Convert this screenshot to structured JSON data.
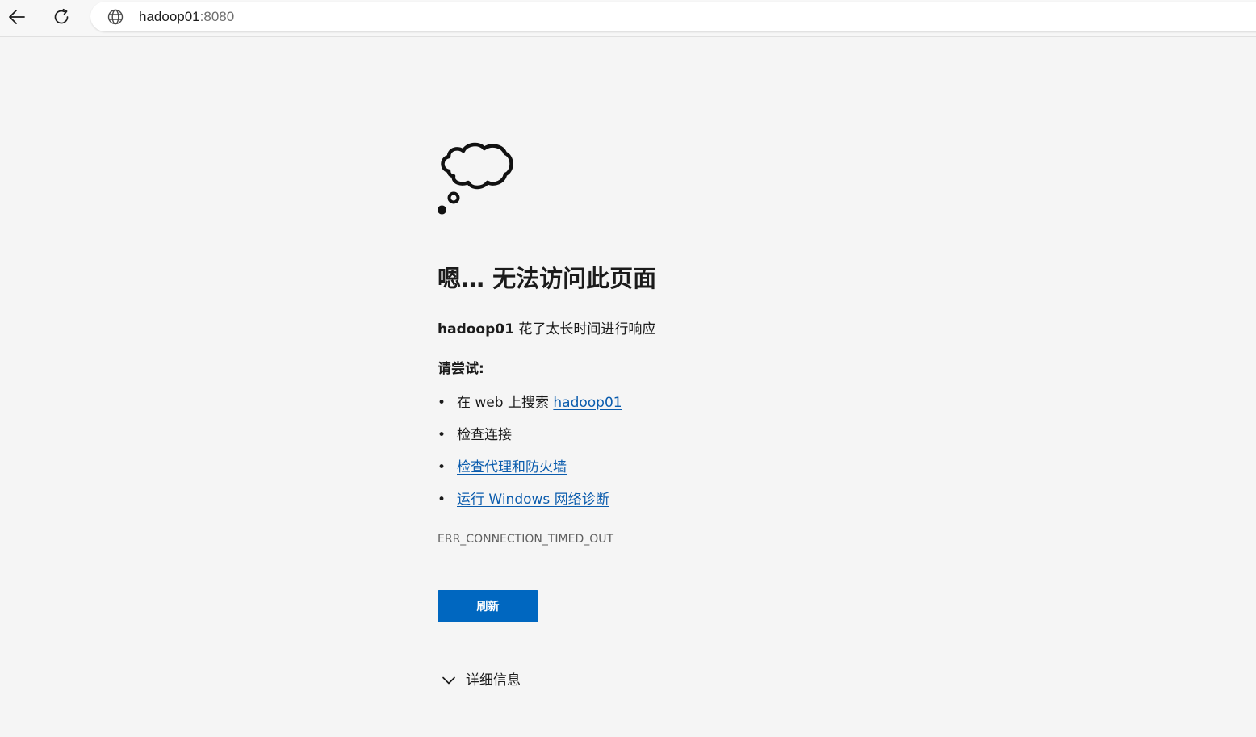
{
  "browser": {
    "back_icon": "arrow-left-icon",
    "reload_icon": "refresh-icon",
    "site_icon": "globe-icon",
    "url_host": "hadoop01",
    "url_port": ":8080"
  },
  "error_page": {
    "illustration_icon": "thought-cloud-icon",
    "title": "嗯… 无法访问此页面",
    "subtitle_host": "hadoop01",
    "subtitle_text": " 花了太长时间进行响应",
    "try_heading": "请尝试:",
    "suggestions": [
      {
        "bullet": "•",
        "prefix": "在 web 上搜索 ",
        "link": "hadoop01"
      },
      {
        "bullet": "•",
        "text": "检查连接"
      },
      {
        "bullet": "•",
        "link": "检查代理和防火墙"
      },
      {
        "bullet": "•",
        "link": "运行 Windows 网络诊断"
      }
    ],
    "error_code": "ERR_CONNECTION_TIMED_OUT",
    "refresh_label": "刷新",
    "details_label": "详细信息",
    "details_icon": "chevron-down-icon",
    "link_color": "#0b5cad",
    "button_color": "#0067c0"
  }
}
